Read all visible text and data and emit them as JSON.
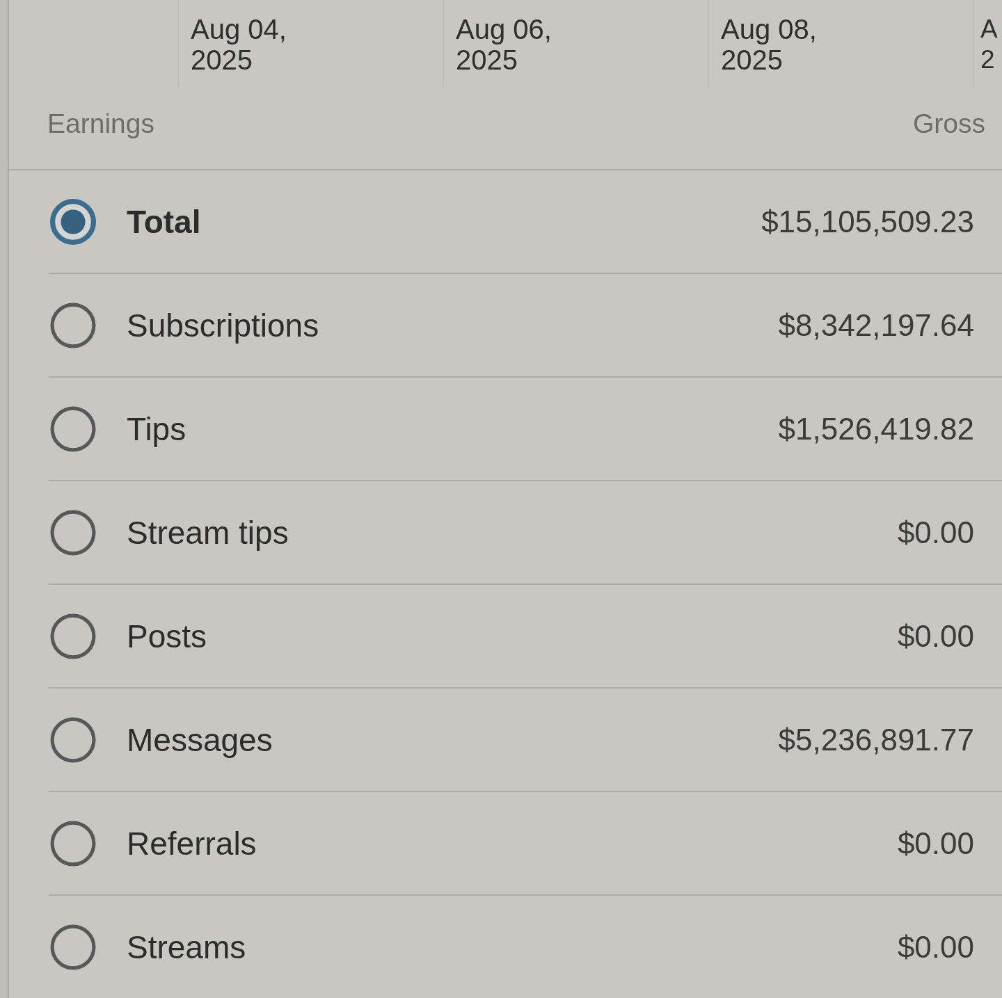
{
  "chart_axis": {
    "ticks": [
      {
        "lines": [
          "Aug 04,",
          "2025"
        ]
      },
      {
        "lines": [
          "Aug 06,",
          "2025"
        ]
      },
      {
        "lines": [
          "Aug 08,",
          "2025"
        ]
      },
      {
        "lines": [
          "A",
          "2"
        ]
      }
    ]
  },
  "table": {
    "columns": [
      {
        "label": "Earnings"
      },
      {
        "label": "Gross"
      }
    ],
    "rows": [
      {
        "label": "Total",
        "amount": "$15,105,509.23",
        "selected": true
      },
      {
        "label": "Subscriptions",
        "amount": "$8,342,197.64",
        "selected": false
      },
      {
        "label": "Tips",
        "amount": "$1,526,419.82",
        "selected": false
      },
      {
        "label": "Stream tips",
        "amount": "$0.00",
        "selected": false
      },
      {
        "label": "Posts",
        "amount": "$0.00",
        "selected": false
      },
      {
        "label": "Messages",
        "amount": "$5,236,891.77",
        "selected": false
      },
      {
        "label": "Referrals",
        "amount": "$0.00",
        "selected": false
      },
      {
        "label": "Streams",
        "amount": "$0.00",
        "selected": false
      }
    ]
  }
}
